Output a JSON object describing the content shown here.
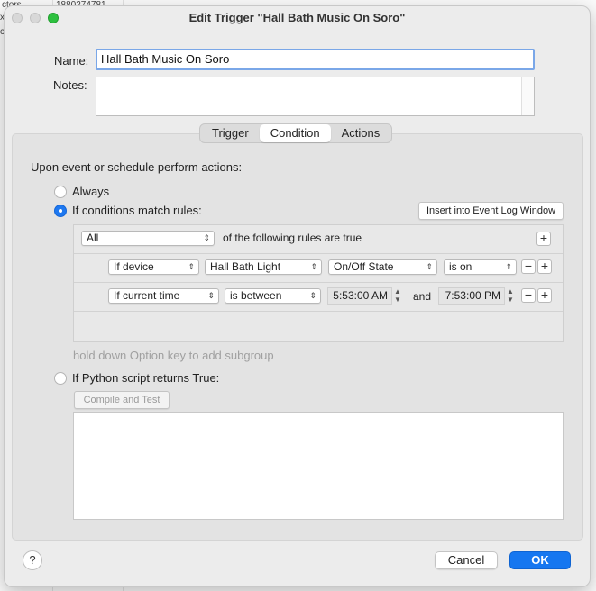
{
  "background": {
    "fragments": [
      "ctors",
      "1880274781",
      "x",
      "c"
    ]
  },
  "window": {
    "title": "Edit Trigger \"Hall Bath Music On Soro\""
  },
  "form": {
    "name_label": "Name:",
    "name_value": "Hall Bath Music On Soro",
    "notes_label": "Notes:",
    "notes_value": ""
  },
  "tabs": [
    {
      "label": "Trigger",
      "active": false
    },
    {
      "label": "Condition",
      "active": true
    },
    {
      "label": "Actions",
      "active": false
    }
  ],
  "condition": {
    "intro": "Upon event or schedule perform actions:",
    "always_label": "Always",
    "match_label": "If conditions match rules:",
    "insert_button": "Insert into Event Log Window",
    "match_mode": "All",
    "match_suffix": "of the following rules are true",
    "rules": [
      {
        "type": "If device",
        "device": "Hall Bath Light",
        "state": "On/Off State",
        "operator": "is on"
      },
      {
        "type": "If current time",
        "operator": "is between",
        "start": "5:53:00 AM",
        "conjunction": "and",
        "end": "7:53:00 PM"
      }
    ],
    "hint": "hold down Option key to add subgroup",
    "python_label": "If Python script returns True:",
    "compile_button": "Compile and Test",
    "selected": "match"
  },
  "footer": {
    "help_label": "?",
    "cancel_label": "Cancel",
    "ok_label": "OK"
  },
  "colors": {
    "accent": "#1677f0",
    "zoom_light": "#2dc03f"
  }
}
